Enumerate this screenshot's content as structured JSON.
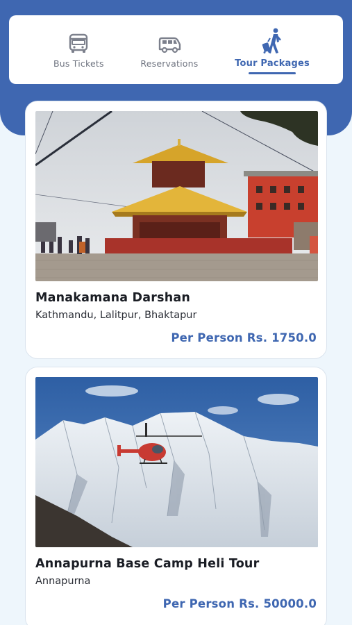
{
  "tabs": [
    {
      "label": "Bus Tickets",
      "icon": "bus-icon",
      "active": false
    },
    {
      "label": "Reservations",
      "icon": "van-icon",
      "active": false
    },
    {
      "label": "Tour Packages",
      "icon": "traveler-luggage-icon",
      "active": true
    }
  ],
  "packages": [
    {
      "title": "Manakamana Darshan",
      "locations": "Kathmandu, Lalitpur, Bhaktapur",
      "price": "Per Person Rs. 1750.0",
      "image": "temple-photo"
    },
    {
      "title": "Annapurna Base Camp Heli Tour",
      "locations": "Annapurna",
      "price": "Per Person Rs. 50000.0",
      "image": "helicopter-mountain-photo"
    }
  ],
  "colors": {
    "primary": "#3f67b1",
    "background": "#eef6fc",
    "card": "#ffffff"
  }
}
